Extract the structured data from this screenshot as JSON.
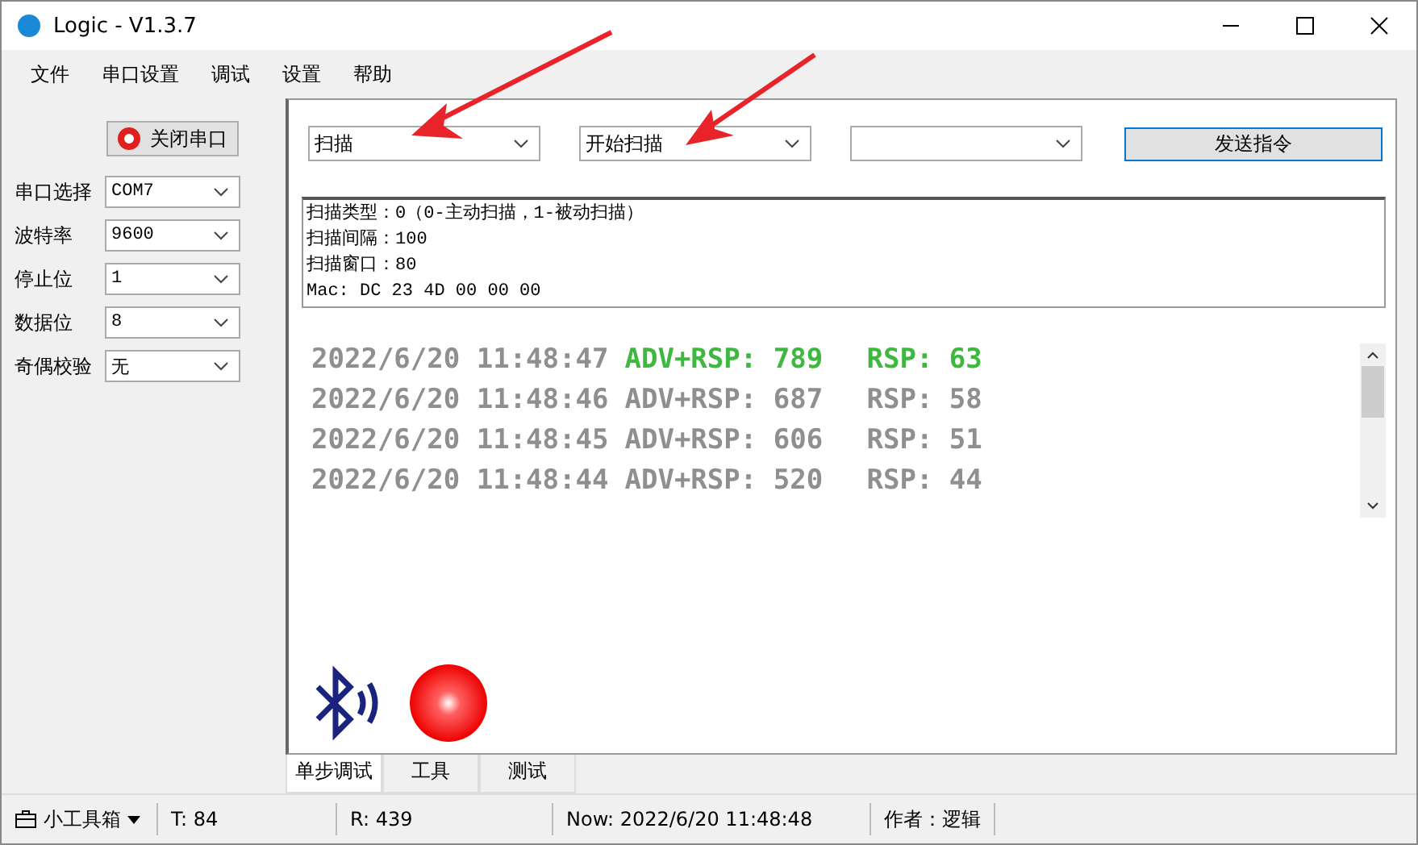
{
  "window": {
    "title": "Logic - V1.3.7"
  },
  "menu": [
    "文件",
    "串口设置",
    "调试",
    "设置",
    "帮助"
  ],
  "sidebar": {
    "port_button": "关闭串口",
    "fields": [
      {
        "label": "串口选择",
        "value": "COM7"
      },
      {
        "label": "波特率",
        "value": "9600"
      },
      {
        "label": "停止位",
        "value": "1"
      },
      {
        "label": "数据位",
        "value": "8"
      },
      {
        "label": "奇偶校验",
        "value": "无"
      }
    ]
  },
  "toolbar": {
    "dropdowns": [
      {
        "kind": "filled",
        "value": "扫描"
      },
      {
        "kind": "filled",
        "value": "开始扫描"
      },
      {
        "kind": "blank"
      }
    ],
    "send_button": "发送指令"
  },
  "info_lines": [
    "扫描类型：0（0-主动扫描，1-被动扫描）",
    "扫描间隔：100",
    "扫描窗口：80",
    "Mac: DC 23 4D 00 00 00"
  ],
  "log": [
    {
      "time": "2022/6/20 11:48:47",
      "adv": "ADV+RSP: 789",
      "rsp": "RSP: 63",
      "highlighted": true
    },
    {
      "time": "2022/6/20 11:48:46",
      "adv": "ADV+RSP: 687",
      "rsp": "RSP: 58",
      "highlighted": false
    },
    {
      "time": "2022/6/20 11:48:45",
      "adv": "ADV+RSP: 606",
      "rsp": "RSP: 51",
      "highlighted": false
    },
    {
      "time": "2022/6/20 11:48:44",
      "adv": "ADV+RSP: 520",
      "rsp": "RSP: 44",
      "highlighted": false
    }
  ],
  "tabs": [
    {
      "label": "单步调试",
      "selected": true
    },
    {
      "label": "工具",
      "selected": false
    },
    {
      "label": "测试",
      "selected": false
    }
  ],
  "status_bar": {
    "toolbox": "小工具箱",
    "t": "T:  84",
    "r": "R:  439",
    "now": "Now:  2022/6/20 11:48:48",
    "author": "作者：逻辑"
  }
}
